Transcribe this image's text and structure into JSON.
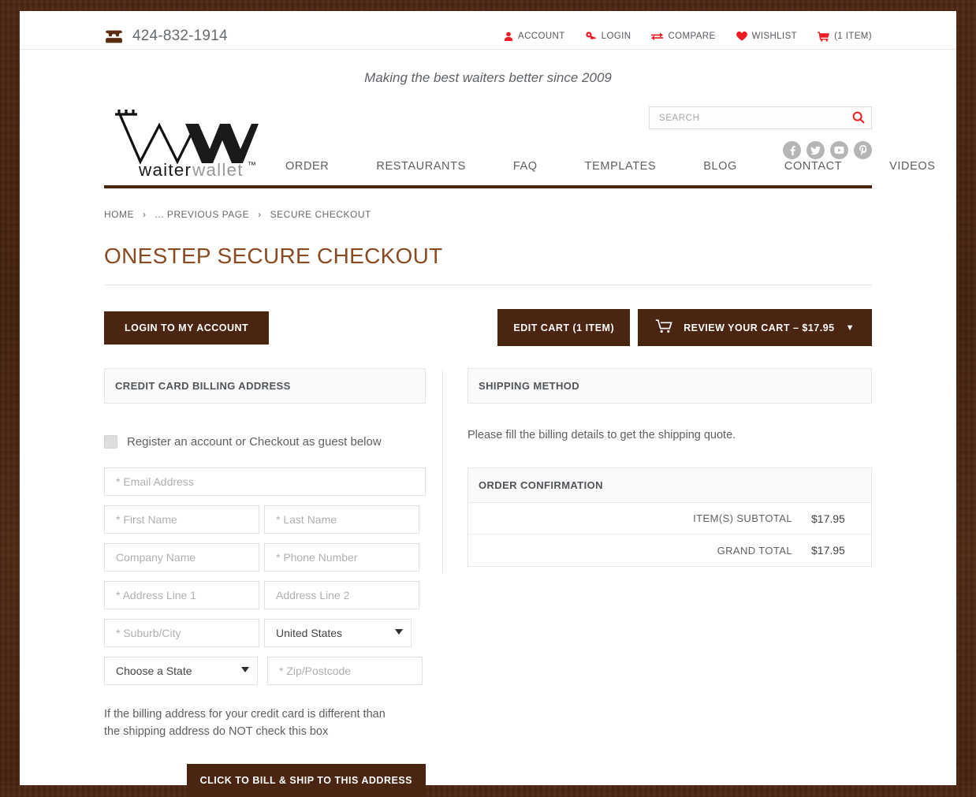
{
  "topbar": {
    "phone": "424-832-1914",
    "phone_icon": "telephone-icon",
    "links": [
      {
        "label": "ACCOUNT",
        "icon": "user-icon"
      },
      {
        "label": "LOGIN",
        "icon": "key-icon"
      },
      {
        "label": "COMPARE",
        "icon": "compare-arrows-icon"
      },
      {
        "label": "WISHLIST",
        "icon": "heart-icon"
      },
      {
        "label": "(1 ITEM)",
        "icon": "cart-icon"
      }
    ]
  },
  "tagline": "Making the best waiters better since 2009",
  "logo": {
    "wordmark": "waiter wallet",
    "tm": "™"
  },
  "search": {
    "placeholder": "SEARCH",
    "value": "",
    "icon": "search-icon"
  },
  "social": [
    {
      "name": "facebook-icon",
      "glyph": "f"
    },
    {
      "name": "twitter-icon",
      "glyph": "t"
    },
    {
      "name": "youtube-icon",
      "glyph": "y"
    },
    {
      "name": "pinterest-icon",
      "glyph": "P"
    }
  ],
  "nav": [
    {
      "label": "ORDER"
    },
    {
      "label": "RESTAURANTS"
    },
    {
      "label": "FAQ"
    },
    {
      "label": "TEMPLATES"
    },
    {
      "label": "BLOG"
    },
    {
      "label": "CONTACT"
    },
    {
      "label": "VIDEOS"
    }
  ],
  "breadcrumb": [
    {
      "label": "HOME"
    },
    {
      "label": "... PREVIOUS PAGE"
    },
    {
      "label": "SECURE CHECKOUT"
    }
  ],
  "page_title": "ONESTEP SECURE CHECKOUT",
  "actions": {
    "login_button": "LOGIN TO MY ACCOUNT",
    "edit_cart_button": "EDIT CART (1 ITEM)",
    "review_cart_button": "REVIEW YOUR CART – $17.95",
    "review_cart_caret": "▼",
    "cart_icon": "cart-icon"
  },
  "billing": {
    "panel_title": "CREDIT CARD BILLING ADDRESS",
    "guest_checkbox_label": "Register an account or Checkout as guest below",
    "guest_checkbox_checked": false,
    "fields": {
      "email": {
        "placeholder": "* Email Address",
        "value": ""
      },
      "first_name": {
        "placeholder": "* First Name",
        "value": ""
      },
      "last_name": {
        "placeholder": "* Last Name",
        "value": ""
      },
      "company": {
        "placeholder": "Company Name",
        "value": ""
      },
      "phone": {
        "placeholder": "* Phone Number",
        "value": ""
      },
      "address1": {
        "placeholder": "* Address Line 1",
        "value": ""
      },
      "address2": {
        "placeholder": "Address Line 2",
        "value": ""
      },
      "city": {
        "placeholder": "* Suburb/City",
        "value": ""
      },
      "zip": {
        "placeholder": "* Zip/Postcode",
        "value": ""
      }
    },
    "country_select": {
      "selected": "United States"
    },
    "state_select": {
      "selected": "Choose a State"
    },
    "note": "If the billing address for your credit card is different than the shipping address do NOT check this box",
    "submit_button": "CLICK TO BILL & SHIP TO THIS ADDRESS"
  },
  "shipping": {
    "panel_title": "SHIPPING METHOD",
    "message": "Please fill the billing details to get the shipping quote."
  },
  "order": {
    "panel_title": "ORDER CONFIRMATION",
    "rows": [
      {
        "label": "ITEM(S) SUBTOTAL",
        "value": "$17.95"
      },
      {
        "label": "GRAND TOTAL",
        "value": "$17.95"
      }
    ]
  },
  "colors": {
    "brand_brown": "#4a2511",
    "title_brown": "#8a4b22",
    "accent_red": "#ee1c24",
    "social_gray": "#b5b5b5"
  }
}
